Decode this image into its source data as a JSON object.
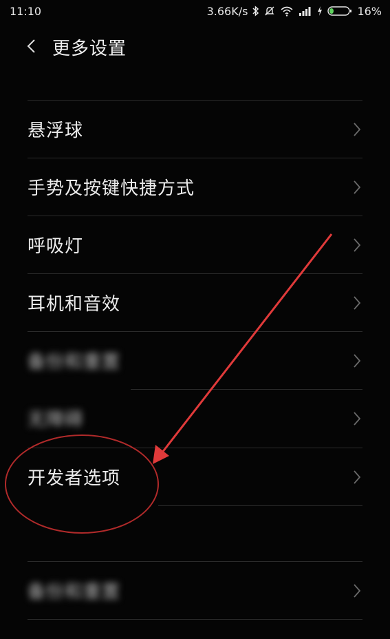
{
  "status_bar": {
    "time": "11:10",
    "network_speed": "3.66K/s",
    "battery_percent": "16%",
    "icons": [
      "bluetooth-icon",
      "mute-icon",
      "wifi-icon",
      "signal-icon",
      "charging-icon",
      "battery-icon"
    ]
  },
  "header": {
    "title": "更多设置",
    "back_icon": "chevron-left-icon"
  },
  "items": [
    {
      "label": "悬浮球"
    },
    {
      "label": "手势及按键快捷方式"
    },
    {
      "label": "呼吸灯"
    },
    {
      "label": "耳机和音效"
    },
    {
      "label": "备份和重置"
    },
    {
      "label": "无障碍"
    },
    {
      "label": "开发者选项"
    },
    {
      "label": "备份和重置"
    }
  ],
  "annotation": {
    "arrow_color": "#e03a3a",
    "circle_color": "#b02a2a",
    "target": "开发者选项"
  }
}
